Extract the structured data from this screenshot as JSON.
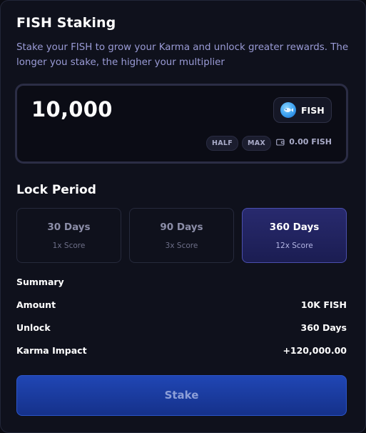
{
  "header": {
    "title": "FISH Staking",
    "subtitle": "Stake your FISH to grow your Karma and unlock greater rewards. The longer you stake, the higher your multiplier"
  },
  "amount_input": {
    "value": "10,000",
    "token": {
      "label": "FISH",
      "icon": "fish-token-icon"
    },
    "half_label": "HALF",
    "max_label": "MAX",
    "balance": "0.00 FISH",
    "balance_icon": "wallet-icon"
  },
  "lock_period": {
    "title": "Lock Period",
    "selected_index": 2,
    "options": [
      {
        "days": "30 Days",
        "score": "1x Score"
      },
      {
        "days": "90 Days",
        "score": "3x Score"
      },
      {
        "days": "360 Days",
        "score": "12x Score"
      }
    ]
  },
  "summary": {
    "title": "Summary",
    "rows": [
      {
        "label": "Amount",
        "value": "10K FISH"
      },
      {
        "label": "Unlock",
        "value": "360 Days"
      },
      {
        "label": "Karma Impact",
        "value": "+120,000.00"
      }
    ]
  },
  "actions": {
    "stake_label": "Stake"
  },
  "colors": {
    "background": "#0f111c",
    "subtitle_text": "#9a9bd6",
    "selected_option": "#282a6e",
    "stake_button": "#2046b4"
  }
}
